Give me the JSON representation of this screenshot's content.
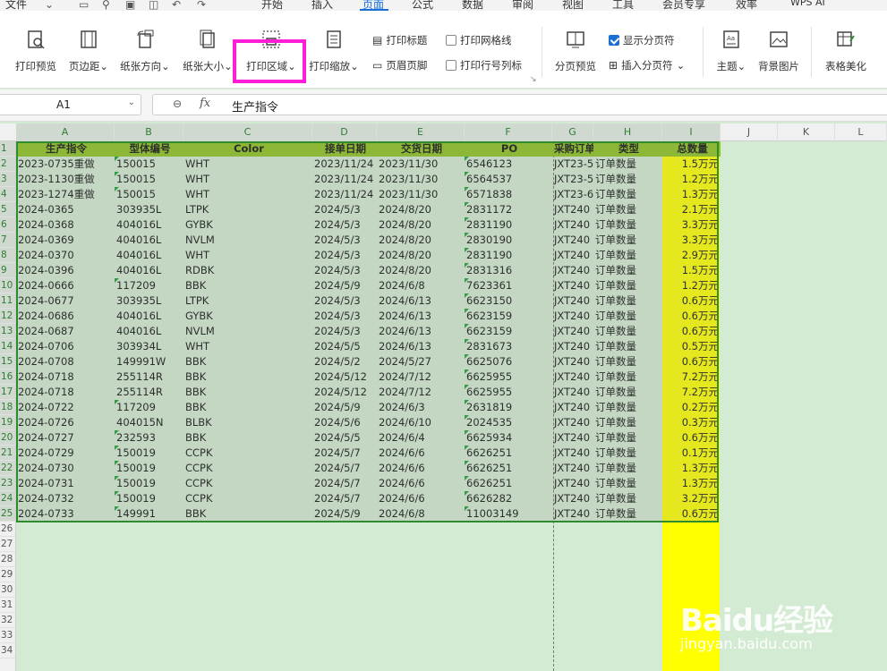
{
  "menubar": {
    "file": "文件",
    "tabs": [
      {
        "label": "开始"
      },
      {
        "label": "插入"
      },
      {
        "label": "页面"
      },
      {
        "label": "公式"
      },
      {
        "label": "数据"
      },
      {
        "label": "审阅"
      },
      {
        "label": "视图"
      },
      {
        "label": "工具"
      },
      {
        "label": "会员专享"
      },
      {
        "label": "效率"
      }
    ],
    "active_tab": "页面",
    "wps_ai": "WPS AI"
  },
  "ribbon": {
    "print_preview": "打印预览",
    "margins": "页边距",
    "orientation": "纸张方向",
    "paper_size": "纸张大小",
    "print_area": "打印区域",
    "print_scale": "打印缩放",
    "print_titles": "打印标题",
    "header_footer": "页眉页脚",
    "print_gridlines": "打印网格线",
    "print_row_col_headers": "打印行号列标",
    "page_break_preview": "分页预览",
    "show_page_breaks": "显示分页符",
    "insert_page_break": "插入分页符",
    "theme": "主题",
    "background_image": "背景图片",
    "table_beautify": "表格美化"
  },
  "formula_bar": {
    "name_box": "A1",
    "fx": "fx",
    "value": "生产指令"
  },
  "columns": [
    "A",
    "B",
    "C",
    "D",
    "E",
    "F",
    "G",
    "H",
    "I",
    "J",
    "K",
    "L"
  ],
  "row_numbers": [
    "1",
    "2",
    "3",
    "4",
    "5",
    "6",
    "7",
    "8",
    "9",
    "10",
    "11",
    "12",
    "13",
    "14",
    "15",
    "16",
    "17",
    "18",
    "19",
    "20",
    "21",
    "22",
    "23",
    "24",
    "25",
    "26",
    "27",
    "28",
    "29",
    "30",
    "31",
    "32",
    "33",
    "34"
  ],
  "headers": [
    "生产指令",
    "型体编号",
    "Color",
    "接单日期",
    "交货日期",
    "PO",
    "采购订单",
    "类型",
    "总数量"
  ],
  "rows": [
    [
      "2023-0735重做",
      "150015",
      "WHT",
      "2023/11/24",
      "2023/11/30",
      "6546123",
      "JXT23-5",
      "订单数量",
      "1.5万元"
    ],
    [
      "2023-1130重做",
      "150015",
      "WHT",
      "2023/11/24",
      "2023/11/30",
      "6564537",
      "JXT23-5",
      "订单数量",
      "1.2万元"
    ],
    [
      "2023-1274重做",
      "150015",
      "WHT",
      "2023/11/24",
      "2023/11/30",
      "6571838",
      "JXT23-6",
      "订单数量",
      "1.3万元"
    ],
    [
      "2024-0365",
      "303935L",
      "LTPK",
      "2024/5/3",
      "2024/8/20",
      "2831172",
      "JXT240",
      "订单数量",
      "2.1万元"
    ],
    [
      "2024-0368",
      "404016L",
      "GYBK",
      "2024/5/3",
      "2024/8/20",
      "2831190",
      "JXT240",
      "订单数量",
      "3.3万元"
    ],
    [
      "2024-0369",
      "404016L",
      "NVLM",
      "2024/5/3",
      "2024/8/20",
      "2830190",
      "JXT240",
      "订单数量",
      "3.3万元"
    ],
    [
      "2024-0370",
      "404016L",
      "WHT",
      "2024/5/3",
      "2024/8/20",
      "2831190",
      "JXT240",
      "订单数量",
      "2.9万元"
    ],
    [
      "2024-0396",
      "404016L",
      "RDBK",
      "2024/5/3",
      "2024/8/20",
      "2831316",
      "JXT240",
      "订单数量",
      "1.5万元"
    ],
    [
      "2024-0666",
      "117209",
      "BBK",
      "2024/5/9",
      "2024/6/8",
      "7623361",
      "JXT240",
      "订单数量",
      "1.2万元"
    ],
    [
      "2024-0677",
      "303935L",
      "LTPK",
      "2024/5/3",
      "2024/6/13",
      "6623150",
      "JXT240",
      "订单数量",
      "0.6万元"
    ],
    [
      "2024-0686",
      "404016L",
      "GYBK",
      "2024/5/3",
      "2024/6/13",
      "6623159",
      "JXT240",
      "订单数量",
      "0.6万元"
    ],
    [
      "2024-0687",
      "404016L",
      "NVLM",
      "2024/5/3",
      "2024/6/13",
      "6623159",
      "JXT240",
      "订单数量",
      "0.6万元"
    ],
    [
      "2024-0706",
      "303934L",
      "WHT",
      "2024/5/5",
      "2024/6/13",
      "2831673",
      "JXT240",
      "订单数量",
      "0.5万元"
    ],
    [
      "2024-0708",
      "149991W",
      "BBK",
      "2024/5/2",
      "2024/5/27",
      "6625076",
      "JXT240",
      "订单数量",
      "0.6万元"
    ],
    [
      "2024-0718",
      "255114R",
      "BBK",
      "2024/5/12",
      "2024/7/12",
      "6625955",
      "JXT240",
      "订单数量",
      "7.2万元"
    ],
    [
      "2024-0718",
      "255114R",
      "BBK",
      "2024/5/12",
      "2024/7/12",
      "6625955",
      "JXT240",
      "订单数量",
      "7.2万元"
    ],
    [
      "2024-0722",
      "117209",
      "BBK",
      "2024/5/9",
      "2024/6/3",
      "2631819",
      "JXT240",
      "订单数量",
      "0.2万元"
    ],
    [
      "2024-0726",
      "404015N",
      "BLBK",
      "2024/5/6",
      "2024/6/10",
      "2024535",
      "JXT240",
      "订单数量",
      "0.3万元"
    ],
    [
      "2024-0727",
      "232593",
      "BBK",
      "2024/5/5",
      "2024/6/4",
      "6625934",
      "JXT240",
      "订单数量",
      "0.6万元"
    ],
    [
      "2024-0729",
      "150019",
      "CCPK",
      "2024/5/7",
      "2024/6/6",
      "6626251",
      "JXT240",
      "订单数量",
      "0.1万元"
    ],
    [
      "2024-0730",
      "150019",
      "CCPK",
      "2024/5/7",
      "2024/6/6",
      "6626251",
      "JXT240",
      "订单数量",
      "1.3万元"
    ],
    [
      "2024-0731",
      "150019",
      "CCPK",
      "2024/5/7",
      "2024/6/6",
      "6626251",
      "JXT240",
      "订单数量",
      "1.3万元"
    ],
    [
      "2024-0732",
      "150019",
      "CCPK",
      "2024/5/7",
      "2024/6/6",
      "6626282",
      "JXT240",
      "订单数量",
      "3.2万元"
    ],
    [
      "2024-0733",
      "149991",
      "BBK",
      "2024/5/9",
      "2024/6/8",
      "11003149",
      "JXT240",
      "订单数量",
      "0.6万元"
    ]
  ],
  "watermark": {
    "brand": "Baidu经验",
    "url": "jingyan.baidu.com"
  },
  "colors": {
    "accent": "#1a6fd6",
    "highlight": "#ff1dd8",
    "header_fill": "#8dc21f",
    "yellow": "#ffff00",
    "grid_bg": "#d3ead3"
  }
}
